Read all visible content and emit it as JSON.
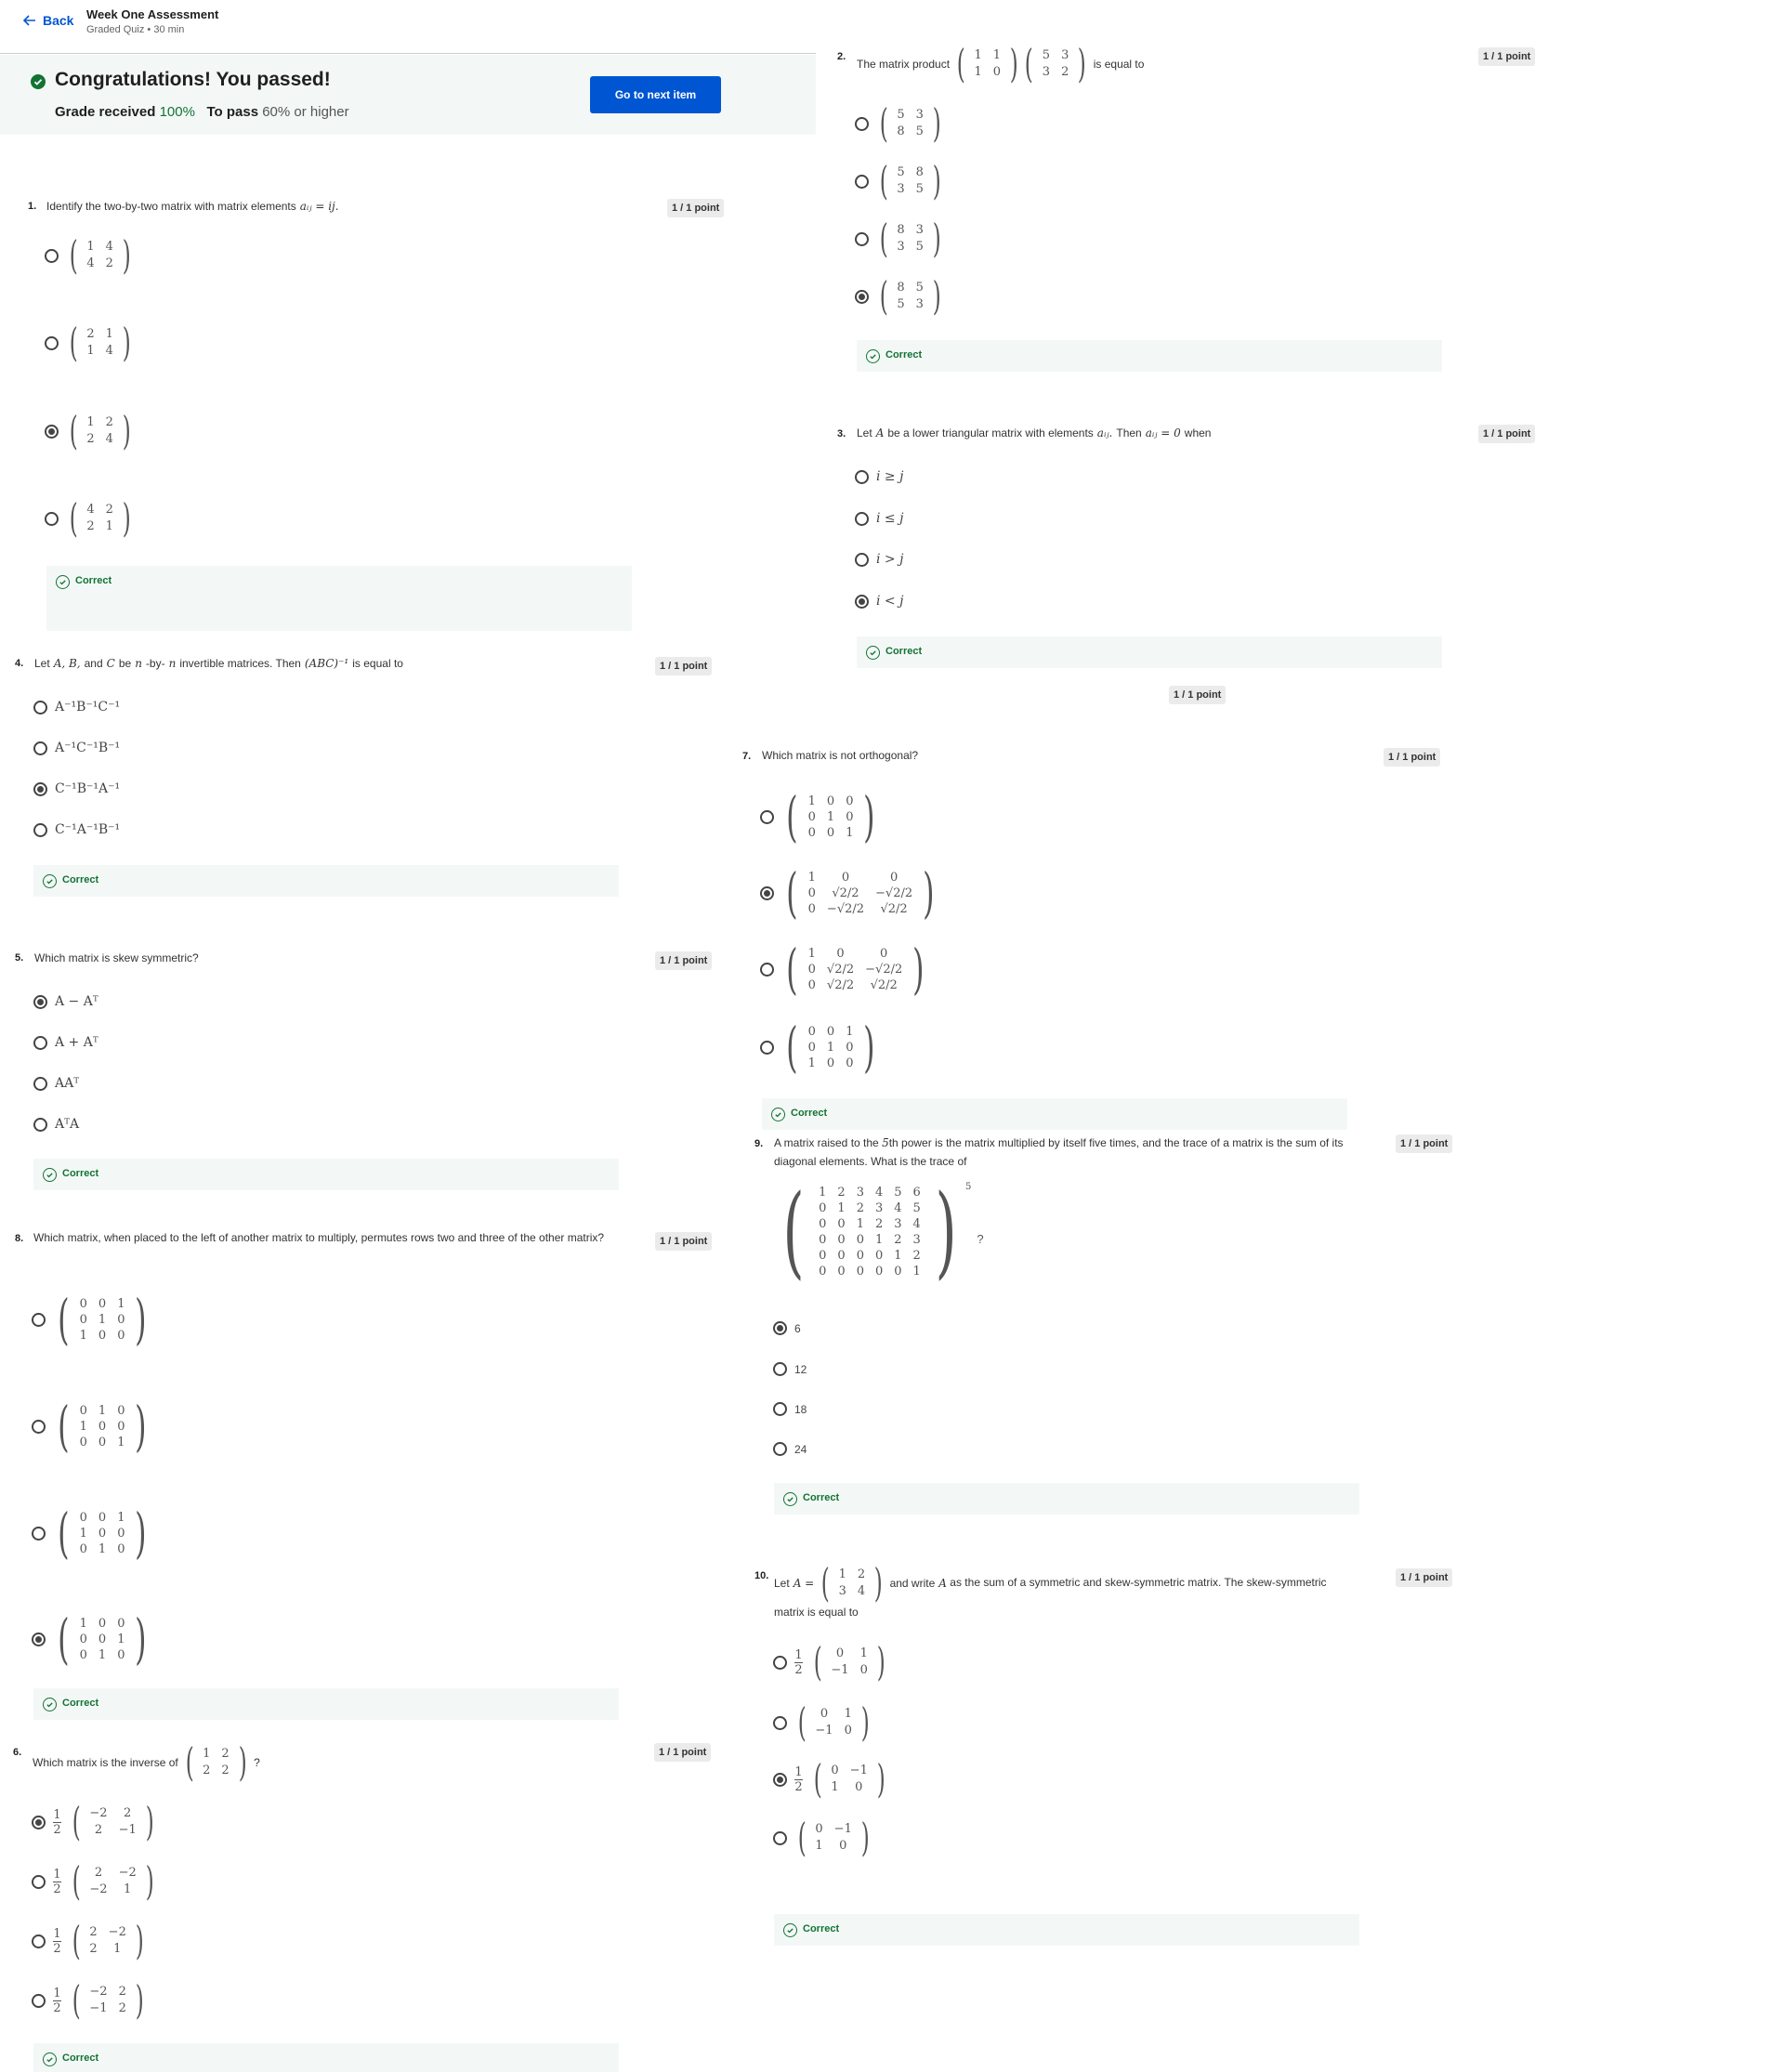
{
  "header": {
    "back_label": "Back",
    "title": "Week One Assessment",
    "subtitle": "Graded Quiz • 30 min"
  },
  "banner": {
    "title": "Congratulations! You passed!",
    "grade_label": "Grade received",
    "grade_value": "100%",
    "pass_label": "To pass",
    "pass_value": "60% or higher",
    "next_button": "Go to next item"
  },
  "feedback_label": "Correct",
  "q1": {
    "num": "1.",
    "text": "Identify the two-by-two matrix with matrix elements",
    "expr": "aᵢⱼ = ij.",
    "points": "1 / 1 point",
    "options": [
      [
        [
          "1",
          "4"
        ],
        [
          "4",
          "2"
        ]
      ],
      [
        [
          "2",
          "1"
        ],
        [
          "1",
          "4"
        ]
      ],
      [
        [
          "1",
          "2"
        ],
        [
          "2",
          "4"
        ]
      ],
      [
        [
          "4",
          "2"
        ],
        [
          "2",
          "1"
        ]
      ]
    ],
    "selected": 2
  },
  "q2": {
    "num": "2.",
    "text": "The matrix product",
    "text2": "is equal to",
    "points": "1 / 1 point",
    "lhs": [
      [
        [
          "1",
          "1"
        ],
        [
          "1",
          "0"
        ]
      ],
      [
        [
          "5",
          "3"
        ],
        [
          "3",
          "2"
        ]
      ]
    ],
    "options": [
      [
        [
          "5",
          "3"
        ],
        [
          "8",
          "5"
        ]
      ],
      [
        [
          "5",
          "8"
        ],
        [
          "3",
          "5"
        ]
      ],
      [
        [
          "8",
          "3"
        ],
        [
          "3",
          "5"
        ]
      ],
      [
        [
          "8",
          "5"
        ],
        [
          "5",
          "3"
        ]
      ]
    ],
    "selected": 3
  },
  "q3": {
    "num": "3.",
    "text_a": "Let",
    "A": "A",
    "text_b": "be a lower triangular matrix with elements",
    "aij": "aᵢⱼ.",
    "text_c": "Then",
    "eq": "aᵢⱼ = 0",
    "text_d": "when",
    "points": "1 / 1 point",
    "options": [
      "i ≥ j",
      "i ≤ j",
      "i > j",
      "i < j"
    ],
    "selected": 3
  },
  "q4": {
    "num": "4.",
    "text_a": "Let",
    "abc": "A, B,",
    "text_and": "and",
    "c": "C",
    "text_be": "be",
    "n": "n",
    "text_by": "-by-",
    "n2": "n",
    "text_b": "invertible matrices.  Then",
    "expr": "(ABC)⁻¹",
    "text_c": "is equal to",
    "points": "1 / 1 point",
    "options": [
      "A⁻¹B⁻¹C⁻¹",
      "A⁻¹C⁻¹B⁻¹",
      "C⁻¹B⁻¹A⁻¹",
      "C⁻¹A⁻¹B⁻¹"
    ],
    "selected": 2
  },
  "q5": {
    "num": "5.",
    "text": "Which matrix is skew symmetric?",
    "points": "1 / 1 point",
    "options": [
      "A − Aᵀ",
      "A + Aᵀ",
      "AAᵀ",
      "AᵀA"
    ],
    "selected": 0
  },
  "q6": {
    "num": "6.",
    "text": "Which matrix is the inverse of",
    "lhs": [
      [
        "1",
        "2"
      ],
      [
        "2",
        "2"
      ]
    ],
    "qmark": "?",
    "points": "1 / 1 point",
    "options": [
      [
        [
          "−2",
          "2"
        ],
        [
          "2",
          "−1"
        ]
      ],
      [
        [
          "2",
          "−2"
        ],
        [
          "−2",
          "1"
        ]
      ],
      [
        [
          "2",
          "−2"
        ],
        [
          "2",
          "1"
        ]
      ],
      [
        [
          "−2",
          "2"
        ],
        [
          "−1",
          "2"
        ]
      ]
    ],
    "frac_n": "1",
    "frac_d": "2",
    "selected": 0
  },
  "q7": {
    "num": "7.",
    "text": "Which matrix is not orthogonal?",
    "points": "1 / 1 point",
    "top_points": "1 / 1 point",
    "options": [
      [
        [
          "1",
          "0",
          "0"
        ],
        [
          "0",
          "1",
          "0"
        ],
        [
          "0",
          "0",
          "1"
        ]
      ],
      [
        [
          "1",
          "0",
          "0"
        ],
        [
          "0",
          "√2/2",
          "−√2/2"
        ],
        [
          "0",
          "−√2/2",
          "√2/2"
        ]
      ],
      [
        [
          "1",
          "0",
          "0"
        ],
        [
          "0",
          "√2/2",
          "−√2/2"
        ],
        [
          "0",
          "√2/2",
          "√2/2"
        ]
      ],
      [
        [
          "0",
          "0",
          "1"
        ],
        [
          "0",
          "1",
          "0"
        ],
        [
          "1",
          "0",
          "0"
        ]
      ]
    ],
    "selected": 1
  },
  "q8": {
    "num": "8.",
    "text": "Which matrix, when placed to the left of another matrix to multiply,  permutes rows two and three of the other matrix?",
    "points": "1 / 1 point",
    "options": [
      [
        [
          "0",
          "0",
          "1"
        ],
        [
          "0",
          "1",
          "0"
        ],
        [
          "1",
          "0",
          "0"
        ]
      ],
      [
        [
          "0",
          "1",
          "0"
        ],
        [
          "1",
          "0",
          "0"
        ],
        [
          "0",
          "0",
          "1"
        ]
      ],
      [
        [
          "0",
          "0",
          "1"
        ],
        [
          "1",
          "0",
          "0"
        ],
        [
          "0",
          "1",
          "0"
        ]
      ],
      [
        [
          "1",
          "0",
          "0"
        ],
        [
          "0",
          "0",
          "1"
        ],
        [
          "0",
          "1",
          "0"
        ]
      ]
    ],
    "selected": 3
  },
  "q9": {
    "num": "9.",
    "text_a": "A matrix raised to the",
    "five": "5",
    "text_b": "th power is the matrix multiplied by itself five times, and the trace of a matrix is the sum of its diagonal elements.  What is the trace of",
    "points": "1 / 1 point",
    "matrix": [
      [
        "1",
        "2",
        "3",
        "4",
        "5",
        "6"
      ],
      [
        "0",
        "1",
        "2",
        "3",
        "4",
        "5"
      ],
      [
        "0",
        "0",
        "1",
        "2",
        "3",
        "4"
      ],
      [
        "0",
        "0",
        "0",
        "1",
        "2",
        "3"
      ],
      [
        "0",
        "0",
        "0",
        "0",
        "1",
        "2"
      ],
      [
        "0",
        "0",
        "0",
        "0",
        "0",
        "1"
      ]
    ],
    "exp": "5",
    "qmark": "?",
    "options": [
      "6",
      "12",
      "18",
      "24"
    ],
    "selected": 0
  },
  "q10": {
    "num": "10.",
    "text_a": "Let",
    "lhs_label": "A =",
    "lhs": [
      [
        "1",
        "2"
      ],
      [
        "3",
        "4"
      ]
    ],
    "text_b": "and write",
    "A": "A",
    "text_c": "as the sum of a symmetric and skew-symmetric matrix.  The skew-symmetric matrix is equal to",
    "points": "1 / 1 point",
    "options": [
      {
        "frac": true,
        "m": [
          [
            "0",
            "1"
          ],
          [
            "−1",
            "0"
          ]
        ]
      },
      {
        "frac": false,
        "m": [
          [
            "0",
            "1"
          ],
          [
            "−1",
            "0"
          ]
        ]
      },
      {
        "frac": true,
        "m": [
          [
            "0",
            "−1"
          ],
          [
            "1",
            "0"
          ]
        ]
      },
      {
        "frac": false,
        "m": [
          [
            "0",
            "−1"
          ],
          [
            "1",
            "0"
          ]
        ]
      }
    ],
    "selected": 2
  }
}
